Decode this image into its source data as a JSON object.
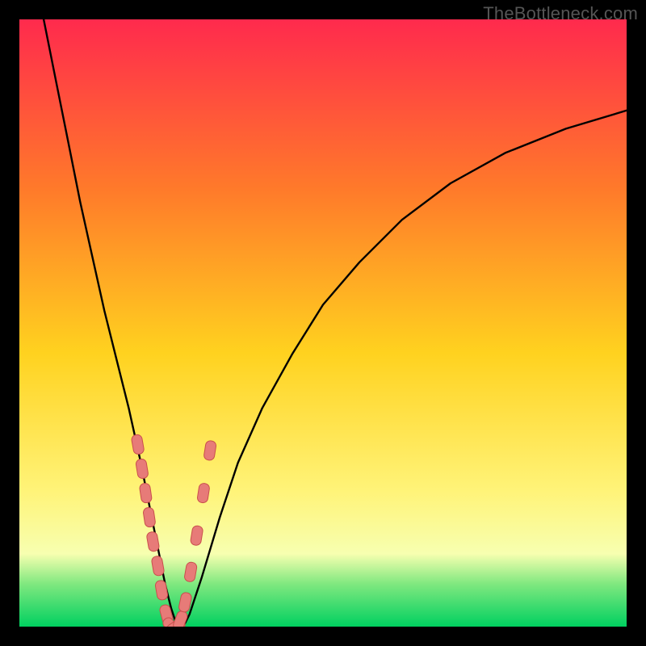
{
  "watermark": "TheBottleneck.com",
  "colors": {
    "frame": "#000000",
    "grad_top": "#ff2a4d",
    "grad_mid1": "#ff7a2a",
    "grad_mid2": "#ffd21f",
    "grad_low": "#fff47a",
    "grad_band_light": "#f7ffb0",
    "grad_band_green": "#7fe87f",
    "grad_bottom": "#00d060",
    "curve": "#000000",
    "marker_fill": "#e77b78",
    "marker_stroke": "#c94f4c"
  },
  "chart_data": {
    "type": "line",
    "title": "",
    "xlabel": "",
    "ylabel": "",
    "xlim": [
      0,
      100
    ],
    "ylim": [
      0,
      100
    ],
    "series": [
      {
        "name": "bottleneck-curve",
        "x": [
          4,
          6,
          8,
          10,
          12,
          14,
          16,
          18,
          20,
          21,
          22,
          23,
          24,
          25,
          26,
          27,
          28,
          30,
          33,
          36,
          40,
          45,
          50,
          56,
          63,
          71,
          80,
          90,
          100
        ],
        "y": [
          100,
          90,
          80,
          70,
          61,
          52,
          44,
          36,
          27,
          22,
          17,
          12,
          7,
          3,
          0,
          0,
          2,
          8,
          18,
          27,
          36,
          45,
          53,
          60,
          67,
          73,
          78,
          82,
          85
        ]
      }
    ],
    "markers": {
      "name": "highlight-points",
      "x": [
        19.5,
        20.2,
        20.8,
        21.4,
        22.0,
        22.8,
        23.4,
        24.2,
        25.0,
        25.8,
        26.5,
        27.3,
        28.2,
        29.2,
        30.3,
        31.4
      ],
      "y": [
        30,
        26,
        22,
        18,
        14,
        10,
        6,
        2,
        0,
        0,
        1,
        4,
        9,
        15,
        22,
        29
      ]
    }
  }
}
